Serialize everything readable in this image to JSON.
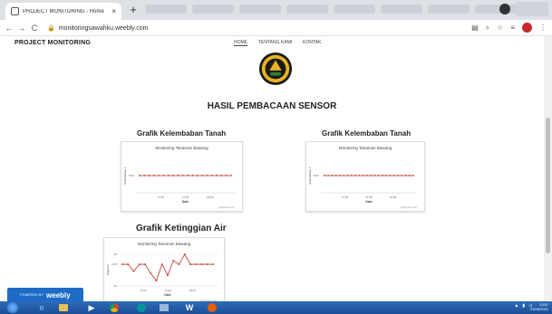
{
  "browser": {
    "tab_title": "PROJECT MONITORING - Home",
    "url": "monitoringsawahku.weebly.com",
    "colors": {
      "tab_strip": "#dee1e6",
      "profile": "#c62828"
    }
  },
  "site": {
    "title": "PROJECT MONITORING",
    "nav": [
      "HOME",
      "TENTANG KAMI",
      "KONTAK"
    ],
    "section_title": "HASIL PEMBACAAN SENSOR",
    "logo_icon": "university-emblem-icon"
  },
  "charts": [
    {
      "heading": "Grafik Kelembaban Tanah",
      "chart_data": {
        "type": "line",
        "title": "Monitoring Tanaman Bawang",
        "xlabel": "Date",
        "ylabel": "Kelembaban T",
        "x_ticks": [
          "17:00",
          "17:30",
          "18:00"
        ],
        "y_ticks": [
          "50.0"
        ],
        "series": [
          {
            "values": [
              50,
              50,
              50,
              50,
              50,
              50,
              50,
              50,
              50,
              50,
              50,
              50,
              50,
              50,
              50,
              50,
              50,
              50,
              50,
              50
            ]
          }
        ],
        "credit": "Highcharts.com",
        "color": "#c0392b"
      }
    },
    {
      "heading": "Grafik Kelembaban Tanah",
      "chart_data": {
        "type": "line",
        "title": "Monitoring Tanaman Bawang",
        "xlabel": "Date",
        "ylabel": "Kelembaban T",
        "x_ticks": [
          "17:00",
          "17:30",
          "18:00"
        ],
        "y_ticks": [
          "50.0"
        ],
        "series": [
          {
            "values": [
              50,
              50,
              50,
              50,
              50,
              50,
              50,
              50,
              50,
              50,
              50,
              50,
              50,
              50,
              50,
              50,
              50,
              50,
              50,
              50,
              50,
              50,
              50,
              50
            ]
          }
        ],
        "credit": "Highcharts.com",
        "color": "#c0392b"
      }
    },
    {
      "heading": "Grafik Ketinggian Air",
      "chart_data": {
        "type": "line",
        "title": "Monitoring Tanaman Bawang",
        "xlabel": "Date",
        "ylabel": "Tinggi Air",
        "x_ticks": [
          "17:00",
          "17:30",
          "18:00"
        ],
        "y_ticks": [
          "20",
          "10.5",
          "-10"
        ],
        "ylim": [
          -10,
          20
        ],
        "series": [
          {
            "values": [
              10.5,
              10.5,
              4,
              10.5,
              10.5,
              2,
              -5,
              10.5,
              0,
              14,
              10.5,
              20,
              10.5,
              10.5,
              10.5,
              10.5,
              10.5
            ]
          }
        ],
        "credit": "Highcharts.com",
        "color": "#c0392b"
      }
    }
  ],
  "weebly_badge": {
    "prefix": "POWERED BY",
    "brand": "weebly"
  },
  "taskbar": {
    "icons": [
      "windows-start-icon",
      "internet-explorer-icon",
      "file-explorer-icon",
      "media-player-icon",
      "chrome-icon",
      "arduino-icon",
      "unknown-app-icon",
      "word-icon",
      "firefox-icon"
    ],
    "time": "13:57",
    "date": "21/06/2021"
  }
}
